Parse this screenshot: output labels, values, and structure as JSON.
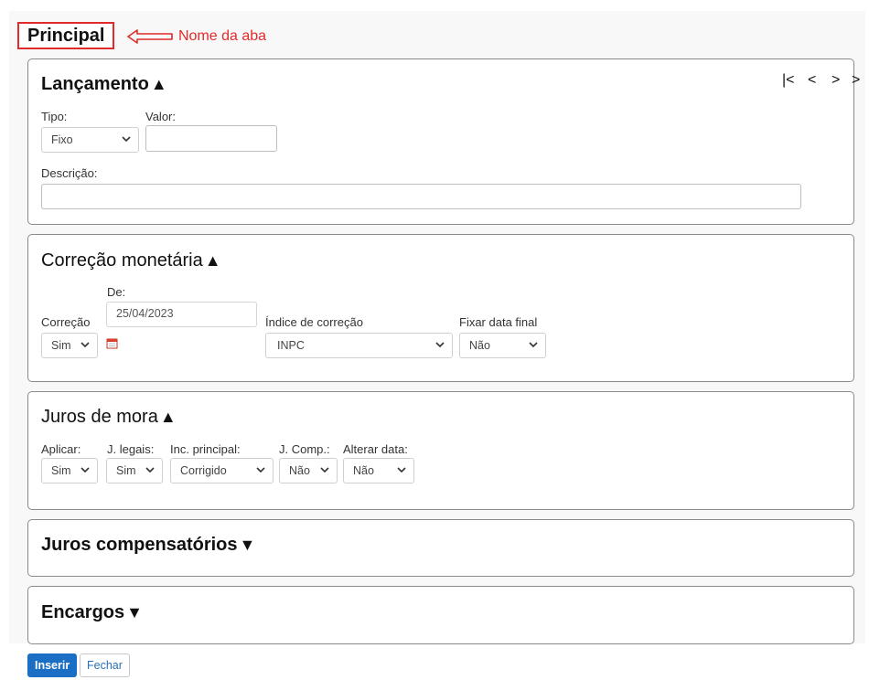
{
  "tab": {
    "name": "Principal"
  },
  "annotation": {
    "label": "Nome da aba",
    "color": "#e02b2b"
  },
  "lancamento": {
    "title": "Lançamento",
    "caret": "▲",
    "nav": {
      "first": "|<",
      "prev": "<",
      "next": ">",
      "last": ">"
    },
    "tipo_label": "Tipo:",
    "tipo_value": "Fixo",
    "valor_label": "Valor:",
    "valor_value": "",
    "descricao_label": "Descrição:",
    "descricao_value": ""
  },
  "correcao": {
    "title": "Correção monetária",
    "caret": "▲",
    "de_label": "De:",
    "de_value": "25/04/2023",
    "correcao_label": "Correção",
    "correcao_value": "Sim",
    "indice_label": "Índice de correção",
    "indice_value": "INPC",
    "fixar_label": "Fixar data final",
    "fixar_value": "Não"
  },
  "juros_mora": {
    "title": "Juros de mora",
    "caret": "▲",
    "aplicar_label": "Aplicar:",
    "aplicar_value": "Sim",
    "jlegais_label": "J. legais:",
    "jlegais_value": "Sim",
    "incprincipal_label": "Inc. principal:",
    "incprincipal_value": "Corrigido",
    "jcomp_label": "J. Comp.:",
    "jcomp_value": "Não",
    "alterar_label": "Alterar data:",
    "alterar_value": "Não"
  },
  "juros_compensatorios": {
    "title": "Juros compensatórios",
    "caret": "▼"
  },
  "encargos": {
    "title": "Encargos",
    "caret": "▼"
  },
  "buttons": {
    "inserir": "Inserir",
    "fechar": "Fechar"
  },
  "colors": {
    "primary": "#1a6fc4",
    "border": "#8a8a8a",
    "annotation": "#e02b2b"
  }
}
